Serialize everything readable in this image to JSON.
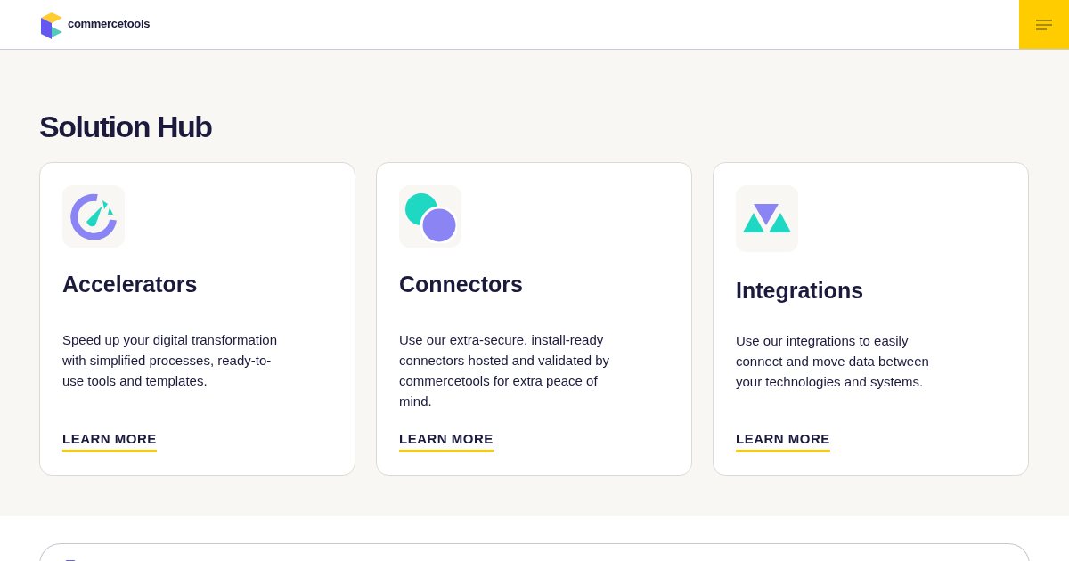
{
  "header": {
    "logo_text": "commercetools"
  },
  "hero": {
    "title": "Solution Hub"
  },
  "cards": [
    {
      "kind": "gauge",
      "title": "Accelerators",
      "description": "Speed up your digital transformation with simplified processes, ready-to-use tools and templates.",
      "link": "LEARN MORE"
    },
    {
      "kind": "circles",
      "title": "Connectors",
      "description": "Use our extra-secure, install-ready connectors hosted and validated by commercetools for extra peace of mind.",
      "link": "LEARN MORE"
    },
    {
      "kind": "triangles",
      "title": "Integrations",
      "description": "Use our integrations to easily connect and move data between your technologies and systems.",
      "link": "LEARN MORE"
    }
  ]
}
